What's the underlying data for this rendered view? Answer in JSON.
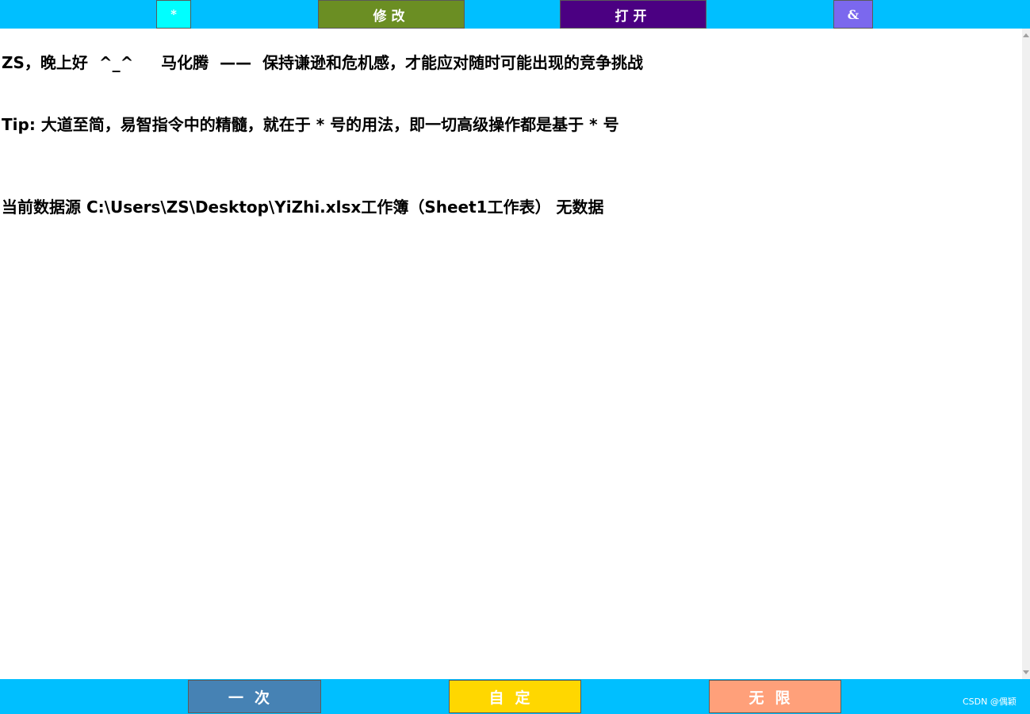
{
  "toolbar_top": {
    "star_label": "*",
    "modify_label": "修改",
    "open_label": "打开",
    "amp_label": "&"
  },
  "content": {
    "greeting": {
      "user": "ZS",
      "separator": "，",
      "salutation": "晚上好",
      "emoticon": "^_^",
      "author": "马化腾",
      "dash": "——",
      "quote": "保持谦逊和危机感，才能应对随时可能出现的竞争挑战"
    },
    "tip": {
      "label": "Tip:",
      "text_1": "大道至简，易智指令中的精髓，就在于",
      "star_1": "*",
      "text_2": "号的用法，即一切高级操作都是基于",
      "star_2": "*",
      "text_3": "号"
    },
    "source": {
      "label": "当前数据源",
      "path": "C:\\Users\\ZS\\Desktop\\YiZhi.xlsx",
      "workbook_suffix": "工作簿（",
      "sheet": "Sheet1",
      "sheet_suffix": "工作表）",
      "status": "无数据"
    }
  },
  "toolbar_bottom": {
    "once_label": "一次",
    "custom_label": "自定",
    "unlimited_label": "无限"
  },
  "watermark": "CSDN @偶颖",
  "colors": {
    "bar_background": "#00bfff",
    "star_button": "#00ffff",
    "modify_button": "#6b8e23",
    "open_button": "#4b0082",
    "amp_button": "#7b68ee",
    "once_button": "#4682b4",
    "custom_button": "#ffd700",
    "unlimited_button": "#ffa07a"
  }
}
